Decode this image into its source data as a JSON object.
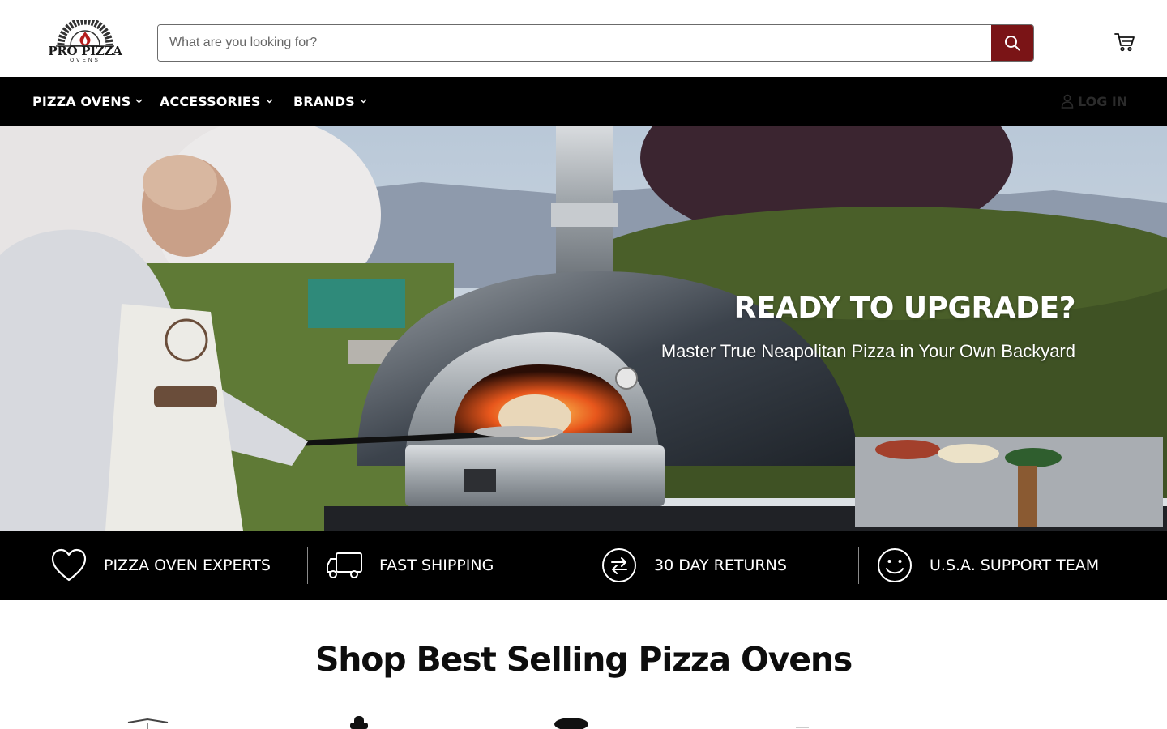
{
  "header": {
    "logo_title": "PRO PIZZA",
    "logo_sub": "OVENS",
    "search_placeholder": "What are you looking for?",
    "colors": {
      "accent": "#7a1416",
      "nav_bg": "#000000"
    },
    "icons": {
      "search": "search-icon",
      "cart": "cart-icon"
    }
  },
  "nav": {
    "items": [
      {
        "label": "PIZZA OVENS"
      },
      {
        "label": "ACCESSORIES"
      },
      {
        "label": "BRANDS"
      }
    ],
    "login_label": "LOG IN"
  },
  "hero": {
    "title": "READY TO UPGRADE?",
    "subtitle": "Master True Neapolitan Pizza in Your Own Backyard"
  },
  "features": [
    {
      "label": "PIZZA OVEN EXPERTS",
      "icon": "heart-icon"
    },
    {
      "label": "FAST SHIPPING",
      "icon": "truck-icon"
    },
    {
      "label": "30 DAY RETURNS",
      "icon": "returns-icon"
    },
    {
      "label": "U.S.A. SUPPORT TEAM",
      "icon": "smiley-icon"
    }
  ],
  "best_sellers": {
    "title": "Shop Best Selling Pizza Ovens"
  }
}
